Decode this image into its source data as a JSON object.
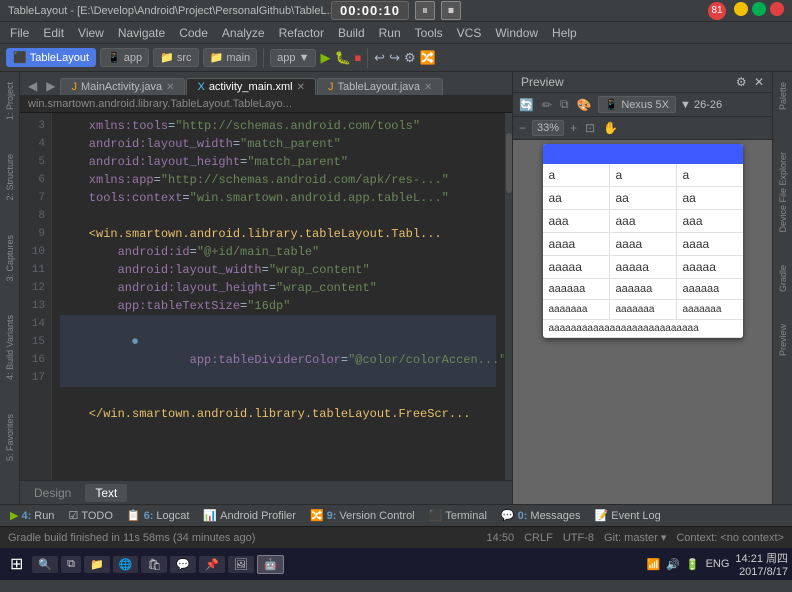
{
  "titleBar": {
    "title": "TableLayout - [E:\\Develop\\Android\\Project\\PersonalGithub\\TableL... ...\\app\\src\\main\\res\\layo...",
    "timer": "00:00:10",
    "pauseLabel": "⏸",
    "stopLabel": "⏹",
    "windowControls": [
      "_",
      "□",
      "✕"
    ],
    "badge": "81"
  },
  "menuBar": {
    "items": [
      "File",
      "Edit",
      "View",
      "Navigate",
      "Code",
      "Analyze",
      "Refactor",
      "Build",
      "Run",
      "Tools",
      "VCS",
      "Window",
      "Help"
    ]
  },
  "toolbar": {
    "items": [
      "TableLayout",
      "app",
      "src",
      "main",
      "app ▼"
    ],
    "runLabel": "▶ Run",
    "icons": [
      "▶",
      "⏹",
      "🐛",
      "🔧",
      "⚙"
    ]
  },
  "editorTabs": [
    {
      "label": "MainActivity.java",
      "active": false,
      "closeable": true
    },
    {
      "label": "activity_main.xml",
      "active": true,
      "closeable": true
    },
    {
      "label": "TableLayout.java",
      "active": false,
      "closeable": true
    }
  ],
  "breadcrumb": "win.smartown.android.library.TableLayout.TableLayo...",
  "codeLines": [
    {
      "num": "3",
      "content": "    xmlns:tools=\"http://schemas.android.com/tools\"",
      "highlight": false
    },
    {
      "num": "4",
      "content": "    android:layout_width=\"match_parent\"",
      "highlight": false
    },
    {
      "num": "5",
      "content": "    android:layout_height=\"match_parent\"",
      "highlight": false
    },
    {
      "num": "6",
      "content": "    xmlns:app=\"http://schemas.android.com/apk/res-...\"",
      "highlight": false
    },
    {
      "num": "7",
      "content": "    tools:context=\"win.smartown.android.app.tableL...\"",
      "highlight": false
    },
    {
      "num": "8",
      "content": "",
      "highlight": false
    },
    {
      "num": "9",
      "content": "    <win.smartown.android.library.tableLayout.Tabl...",
      "highlight": false
    },
    {
      "num": "10",
      "content": "        android:id=\"@+id/main_table\"",
      "highlight": false
    },
    {
      "num": "11",
      "content": "        android:layout_width=\"wrap_content\"",
      "highlight": false
    },
    {
      "num": "12",
      "content": "        android:layout_height=\"wrap_content\"",
      "highlight": false
    },
    {
      "num": "13",
      "content": "        app:tableTextSize=\"16dp\"",
      "highlight": false
    },
    {
      "num": "14",
      "content": "        app:tableDividerColor=\"@color/colorAccen...",
      "highlight": true
    },
    {
      "num": "15",
      "content": "",
      "highlight": false
    },
    {
      "num": "16",
      "content": "    </win.smartown.android.library.tableLayout.FreeScr...",
      "highlight": false
    },
    {
      "num": "17",
      "content": "",
      "highlight": false
    }
  ],
  "editorBottomTabs": [
    {
      "label": "Design",
      "active": false
    },
    {
      "label": "Text",
      "active": true
    }
  ],
  "preview": {
    "title": "Preview",
    "device": "Nexus 5X",
    "zoom": "33%",
    "apiLevel": "26",
    "tableRows": [
      {
        "cells": [
          "a",
          "a",
          "a"
        ]
      },
      {
        "cells": [
          "aa",
          "aa",
          "aa"
        ]
      },
      {
        "cells": [
          "aaa",
          "aaa",
          "aaa"
        ]
      },
      {
        "cells": [
          "aaaa",
          "aaaa",
          "aaaa"
        ]
      },
      {
        "cells": [
          "aaaaa",
          "aaaaa",
          "aaaaa"
        ]
      },
      {
        "cells": [
          "aaaaaa",
          "aaaaaa",
          "aaaaaa"
        ]
      },
      {
        "cells": [
          "aaaaaaa",
          "aaaaaaa",
          "aaaaaaa"
        ]
      }
    ],
    "longRow": "aaaaaaaaaaaaaaaaaaaaaaaaaaa"
  },
  "rightSidebar": {
    "tabs": [
      "Palette",
      "Device File Explorer"
    ]
  },
  "leftSidebar": {
    "tabs": [
      "1: Project",
      "2: Structure",
      "3: Captures",
      "4: Build Variants",
      "5: Favorites"
    ]
  },
  "bottomTools": [
    {
      "num": "4",
      "label": "Run"
    },
    {
      "num": "",
      "label": "TODO"
    },
    {
      "num": "6",
      "label": "Logcat"
    },
    {
      "num": "",
      "label": "Android Profiler"
    },
    {
      "num": "9",
      "label": "Version Control"
    },
    {
      "num": "",
      "label": "Terminal"
    },
    {
      "num": "0",
      "label": "Messages"
    },
    {
      "num": "",
      "label": "Event Log"
    }
  ],
  "statusBar": {
    "buildStatus": "Gradle build finished in 11s 58ms (34 minutes ago)",
    "position": "14:50",
    "lineEnding": "CRLF",
    "encoding": "UTF-8",
    "branch": "Git: master ▾",
    "context": "Context: <no context>"
  },
  "taskbar": {
    "time": "14:21 周四",
    "date": "2017/8/17",
    "language": "ENG"
  }
}
